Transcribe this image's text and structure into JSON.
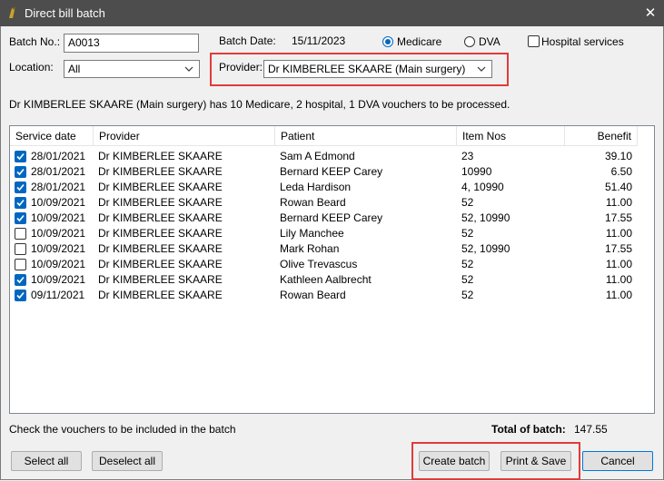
{
  "window": {
    "title": "Direct bill batch",
    "close_glyph": "✕"
  },
  "header": {
    "batch_no_label": "Batch No.:",
    "batch_no_value": "A0013",
    "batch_date_label": "Batch Date:",
    "batch_date_value": "15/11/2023",
    "radio_medicare": "Medicare",
    "radio_dva": "DVA",
    "hospital_services": "Hospital services",
    "location_label": "Location:",
    "location_value": "All",
    "provider_label": "Provider:",
    "provider_value": "Dr KIMBERLEE SKAARE (Main surgery)"
  },
  "summary": "Dr KIMBERLEE SKAARE (Main surgery) has 10 Medicare, 2 hospital, 1 DVA vouchers to be processed.",
  "grid": {
    "columns": [
      "Service date",
      "Provider",
      "Patient",
      "Item Nos",
      "Benefit"
    ],
    "rows": [
      {
        "checked": true,
        "date": "28/01/2021",
        "provider": "Dr KIMBERLEE SKAARE",
        "patient": "Sam A Edmond",
        "items": "23",
        "benefit": "39.10"
      },
      {
        "checked": true,
        "date": "28/01/2021",
        "provider": "Dr KIMBERLEE SKAARE",
        "patient": "Bernard KEEP Carey",
        "items": "10990",
        "benefit": "6.50"
      },
      {
        "checked": true,
        "date": "28/01/2021",
        "provider": "Dr KIMBERLEE SKAARE",
        "patient": "Leda Hardison",
        "items": "4, 10990",
        "benefit": "51.40"
      },
      {
        "checked": true,
        "date": "10/09/2021",
        "provider": "Dr KIMBERLEE SKAARE",
        "patient": "Rowan Beard",
        "items": "52",
        "benefit": "11.00"
      },
      {
        "checked": true,
        "date": "10/09/2021",
        "provider": "Dr KIMBERLEE SKAARE",
        "patient": "Bernard KEEP Carey",
        "items": "52, 10990",
        "benefit": "17.55"
      },
      {
        "checked": false,
        "date": "10/09/2021",
        "provider": "Dr KIMBERLEE SKAARE",
        "patient": "Lily Manchee",
        "items": "52",
        "benefit": "11.00"
      },
      {
        "checked": false,
        "date": "10/09/2021",
        "provider": "Dr KIMBERLEE SKAARE",
        "patient": "Mark Rohan",
        "items": "52, 10990",
        "benefit": "17.55"
      },
      {
        "checked": false,
        "date": "10/09/2021",
        "provider": "Dr KIMBERLEE SKAARE",
        "patient": "Olive Trevascus",
        "items": "52",
        "benefit": "11.00"
      },
      {
        "checked": true,
        "date": "10/09/2021",
        "provider": "Dr KIMBERLEE SKAARE",
        "patient": "Kathleen Aalbrecht",
        "items": "52",
        "benefit": "11.00"
      },
      {
        "checked": true,
        "date": "09/11/2021",
        "provider": "Dr KIMBERLEE SKAARE",
        "patient": "Rowan Beard",
        "items": "52",
        "benefit": "11.00"
      }
    ]
  },
  "footer": {
    "hint": "Check the vouchers to be included in the batch",
    "total_label": "Total of batch:",
    "total_value": "147.55",
    "select_all": "Select all",
    "deselect_all": "Deselect all",
    "create_batch": "Create batch",
    "print_save": "Print & Save",
    "cancel": "Cancel"
  },
  "colors": {
    "accent": "#0067c0",
    "highlight": "#e03b3b",
    "titlebar": "#4d4d4d"
  }
}
